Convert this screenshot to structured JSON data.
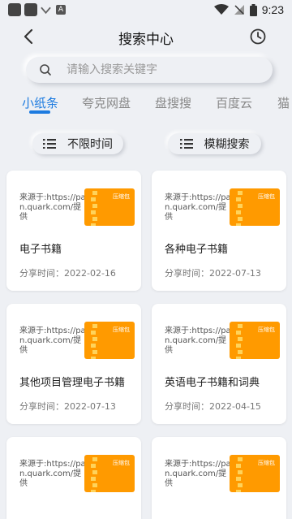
{
  "statusbar": {
    "time": "9:23",
    "badge": "A"
  },
  "header": {
    "title": "搜索中心"
  },
  "search": {
    "placeholder": "请输入搜索关键字"
  },
  "tabs": [
    {
      "label": "小纸条",
      "active": true
    },
    {
      "label": "夸克网盘",
      "active": false
    },
    {
      "label": "盘搜搜",
      "active": false
    },
    {
      "label": "百度云",
      "active": false
    },
    {
      "label": "猫",
      "active": false
    }
  ],
  "filters": {
    "time": "不限时间",
    "mode": "模糊搜索"
  },
  "accent_color": "#1d7be0",
  "thumb_color": "#ff9a00",
  "cards": [
    {
      "source": "来源于:https://pan.quark.com/提供",
      "thumb_label": "压缩包",
      "name": "电子书籍",
      "date": "分享时间：2022-02-16"
    },
    {
      "source": "来源于:https://pan.quark.com/提供",
      "thumb_label": "压缩包",
      "name": "各种电子书籍",
      "date": "分享时间：2022-07-13"
    },
    {
      "source": "来源于:https://pan.quark.com/提供",
      "thumb_label": "压缩包",
      "name": "其他项目管理电子书籍",
      "date": "分享时间：2022-07-13"
    },
    {
      "source": "来源于:https://pan.quark.com/提供",
      "thumb_label": "压缩包",
      "name": "英语电子书籍和词典",
      "date": "分享时间：2022-04-15"
    },
    {
      "source": "来源于:https://pan.quark.com/提供",
      "thumb_label": "压缩包",
      "name": "",
      "date": ""
    },
    {
      "source": "来源于:https://pan.quark.com/提供",
      "thumb_label": "压缩包",
      "name": "",
      "date": ""
    }
  ]
}
